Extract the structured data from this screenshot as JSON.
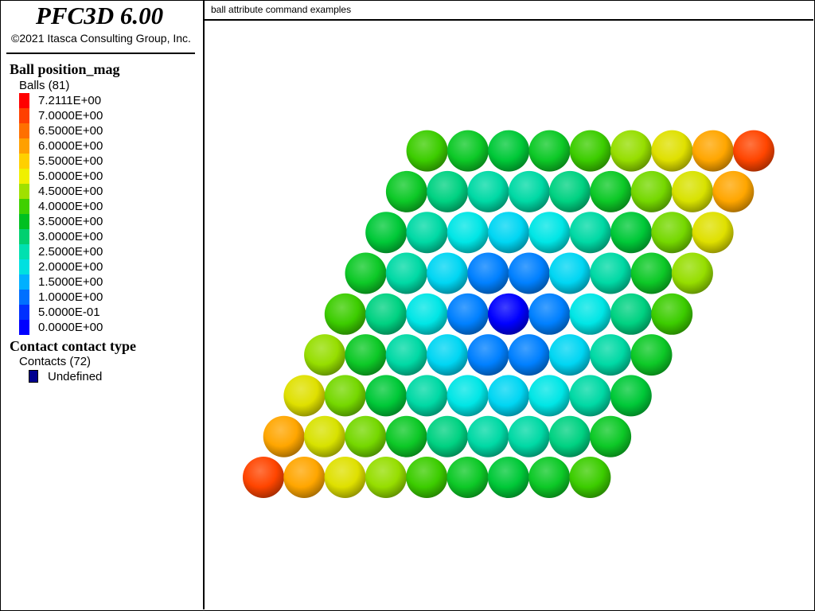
{
  "app": {
    "title": "PFC3D 6.00",
    "copyright": "©2021 Itasca Consulting Group, Inc."
  },
  "legend": {
    "ball_section_title": "Ball position_mag",
    "ball_count_label": "Balls (81)",
    "scale": [
      {
        "label": "7.2111E+00",
        "color": "#ff0000"
      },
      {
        "label": "7.0000E+00",
        "color": "#ff4000"
      },
      {
        "label": "6.5000E+00",
        "color": "#ff7000"
      },
      {
        "label": "6.0000E+00",
        "color": "#ffa000"
      },
      {
        "label": "5.5000E+00",
        "color": "#ffd000"
      },
      {
        "label": "5.0000E+00",
        "color": "#f0f000"
      },
      {
        "label": "4.5000E+00",
        "color": "#a0e000"
      },
      {
        "label": "4.0000E+00",
        "color": "#40d000"
      },
      {
        "label": "3.5000E+00",
        "color": "#00c020"
      },
      {
        "label": "3.0000E+00",
        "color": "#00d070"
      },
      {
        "label": "2.5000E+00",
        "color": "#00e0b0"
      },
      {
        "label": "2.0000E+00",
        "color": "#00e0e0"
      },
      {
        "label": "1.5000E+00",
        "color": "#00b0ff"
      },
      {
        "label": "1.0000E+00",
        "color": "#0070ff"
      },
      {
        "label": "5.0000E-01",
        "color": "#0030ff"
      },
      {
        "label": "0.0000E+00",
        "color": "#0000ff"
      }
    ],
    "contact_section_title": "Contact contact type",
    "contact_count_label": "Contacts (72)",
    "contact_type": {
      "label": "Undefined",
      "color": "#00008f"
    }
  },
  "plot": {
    "title": "ball attribute command examples",
    "ball_grid": {
      "rows": 9,
      "cols": 9
    }
  }
}
